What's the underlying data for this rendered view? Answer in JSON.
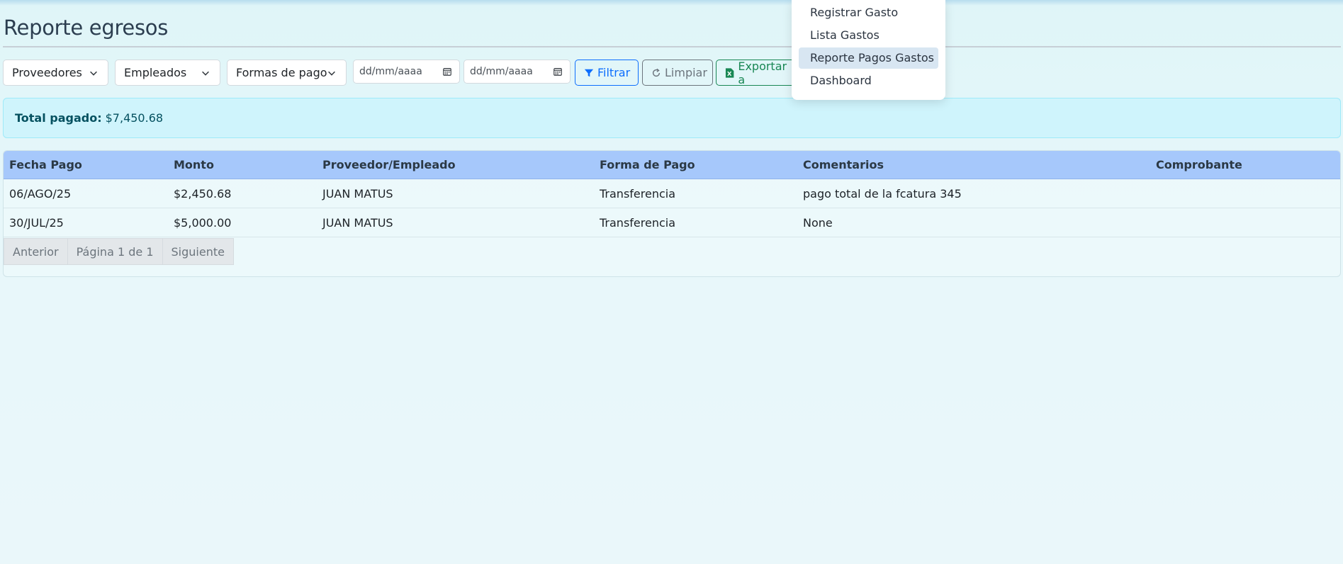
{
  "page": {
    "title": "Reporte egresos"
  },
  "filters": {
    "proveedores": "Proveedores",
    "empleados": "Empleados",
    "formas_pago": "Formas de pago",
    "fecha_desde_placeholder": "dd/mm/aaaa",
    "fecha_hasta_placeholder": "dd/mm/aaaa",
    "filtrar_label": "Filtrar",
    "limpiar_label": "Limpiar",
    "exportar_label": "Exportar a"
  },
  "summary": {
    "label": "Total pagado:",
    "value": "$7,450.68"
  },
  "table": {
    "headers": [
      "Fecha Pago",
      "Monto",
      "Proveedor/Empleado",
      "Forma de Pago",
      "Comentarios",
      "Comprobante"
    ],
    "rows": [
      [
        "06/AGO/25",
        "$2,450.68",
        "JUAN MATUS",
        "Transferencia",
        "pago total de la fcatura 345",
        ""
      ],
      [
        "30/JUL/25",
        "$5,000.00",
        "JUAN MATUS",
        "Transferencia",
        "None",
        ""
      ]
    ]
  },
  "pagination": {
    "prev": "Anterior",
    "page_info": "Página 1 de 1",
    "next": "Siguiente"
  },
  "menu": {
    "items": [
      "Registrar Gasto",
      "Lista Gastos",
      "Reporte Pagos Gastos",
      "Dashboard"
    ],
    "active_index": 2
  },
  "colors": {
    "header_bg": "#a6c8fb",
    "alert_bg": "#cff4fc",
    "primary": "#0d6efd",
    "success": "#198754"
  }
}
